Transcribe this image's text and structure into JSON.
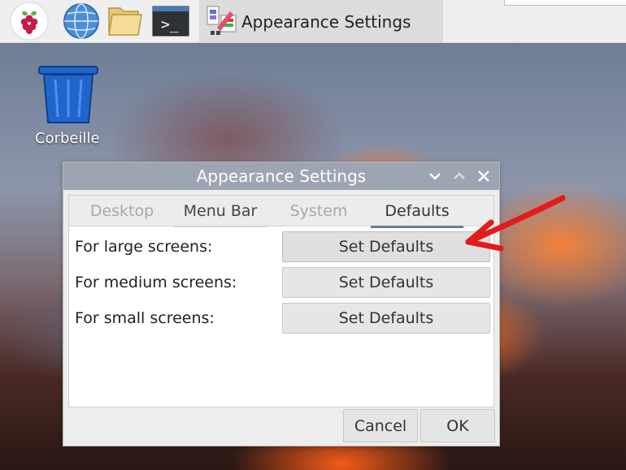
{
  "desktop": {
    "trash_label": "Corbeille"
  },
  "taskbar": {
    "active_task_label": "Appearance Settings",
    "launchers": [
      {
        "icon": "raspberry-pi-icon"
      },
      {
        "icon": "globe-icon"
      },
      {
        "icon": "folder-icon"
      },
      {
        "icon": "terminal-icon"
      }
    ],
    "terminal_prompt": ">_"
  },
  "window": {
    "title": "Appearance Settings",
    "tabs": [
      {
        "label": "Desktop"
      },
      {
        "label": "Menu Bar"
      },
      {
        "label": "System"
      },
      {
        "label": "Defaults"
      }
    ],
    "rows": [
      {
        "label": "For large screens:",
        "button": "Set Defaults"
      },
      {
        "label": "For medium screens:",
        "button": "Set Defaults"
      },
      {
        "label": "For small screens:",
        "button": "Set Defaults"
      }
    ],
    "buttons": {
      "cancel": "Cancel",
      "ok": "OK"
    }
  },
  "colors": {
    "accent_tab": "#6f7c91",
    "annotation_arrow": "#e21b1b"
  }
}
